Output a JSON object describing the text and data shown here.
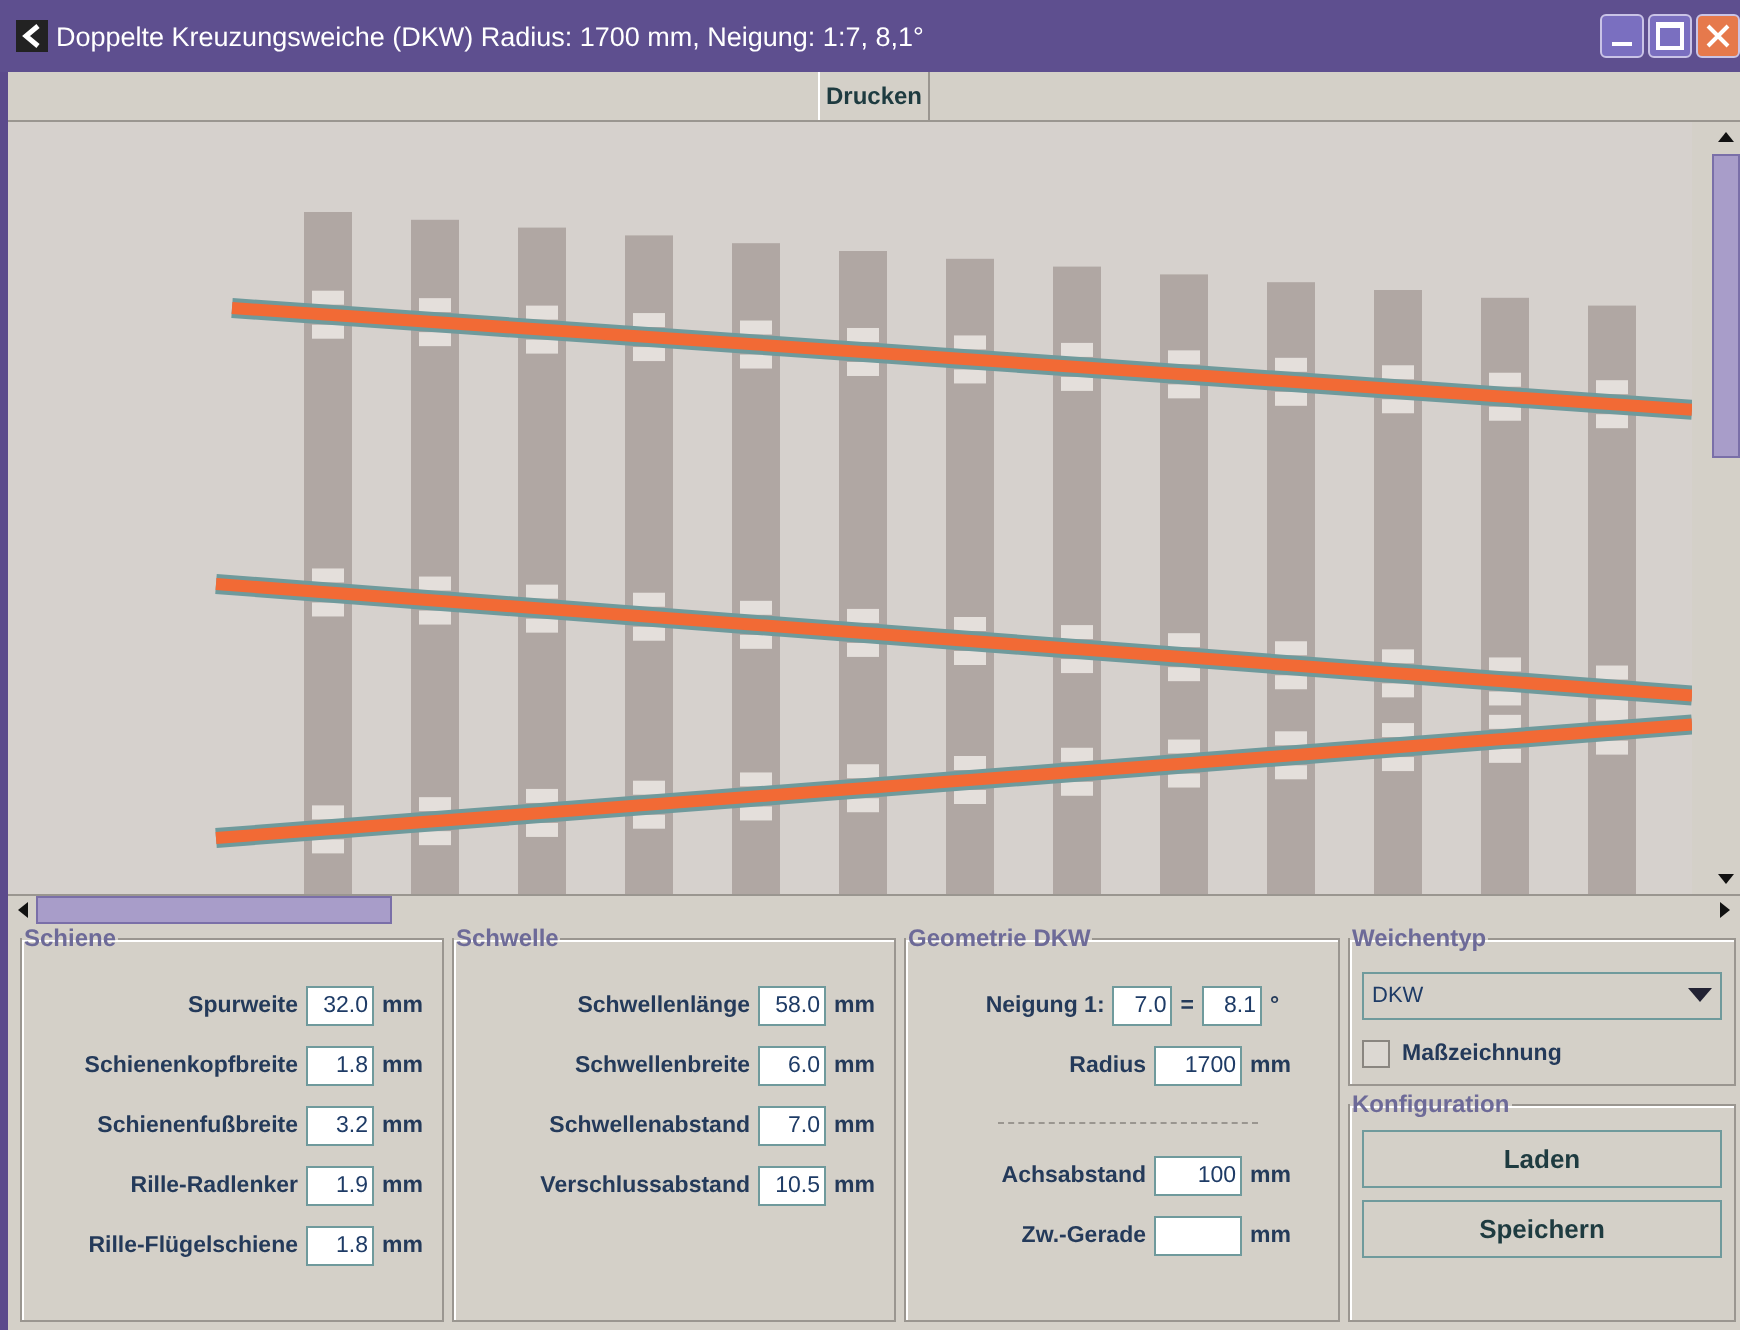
{
  "window": {
    "title": "Doppelte Kreuzungsweiche (DKW) Radius: 1700 mm, Neigung: 1:7, 8,1°"
  },
  "toolbar": {
    "buttons": [
      "Drucken"
    ]
  },
  "canvas": {
    "kind": "track-drawing"
  },
  "panels": [
    {
      "title": "Schiene",
      "fields": [
        {
          "label": "Spurweite",
          "value": "32.0",
          "unit": "mm"
        },
        {
          "label": "Schienenkopfbreite",
          "value": "1.8",
          "unit": "mm"
        },
        {
          "label": "Schienenfußbreite",
          "value": "3.2",
          "unit": "mm"
        },
        {
          "label": "Rille-Radlenker",
          "value": "1.9",
          "unit": "mm"
        },
        {
          "label": "Rille-Flügelschiene",
          "value": "1.8",
          "unit": "mm"
        }
      ]
    },
    {
      "title": "Schwelle",
      "fields": [
        {
          "label": "Schwellenlänge",
          "value": "58.0",
          "unit": "mm"
        },
        {
          "label": "Schwellenbreite",
          "value": "6.0",
          "unit": "mm"
        },
        {
          "label": "Schwellenabstand",
          "value": "7.0",
          "unit": "mm"
        },
        {
          "label": "Verschlussabstand",
          "value": "10.5",
          "unit": "mm"
        }
      ]
    }
  ],
  "geometry": {
    "title": "Geometrie DKW",
    "groups": [
      [
        {
          "kind": "slope",
          "label": "Neigung 1:",
          "value": "7.0",
          "equals": "=",
          "angle": "8.1",
          "unit": "°"
        },
        {
          "kind": "measure",
          "label": "Radius",
          "value": "1700",
          "unit": "mm"
        }
      ],
      [
        {
          "kind": "measure",
          "label": "Achsabstand",
          "value": "100",
          "unit": "mm"
        },
        {
          "kind": "measure",
          "label": "Zw.-Gerade",
          "unit": "mm"
        }
      ]
    ]
  },
  "switch_type": {
    "title": "Weichentyp",
    "dropdown": "DKW",
    "checkbox": {
      "label": "Maßzeichnung",
      "checked": false
    }
  },
  "configuration": {
    "title": "Konfiguration",
    "buttons": [
      "Laden",
      "Speichern"
    ]
  }
}
